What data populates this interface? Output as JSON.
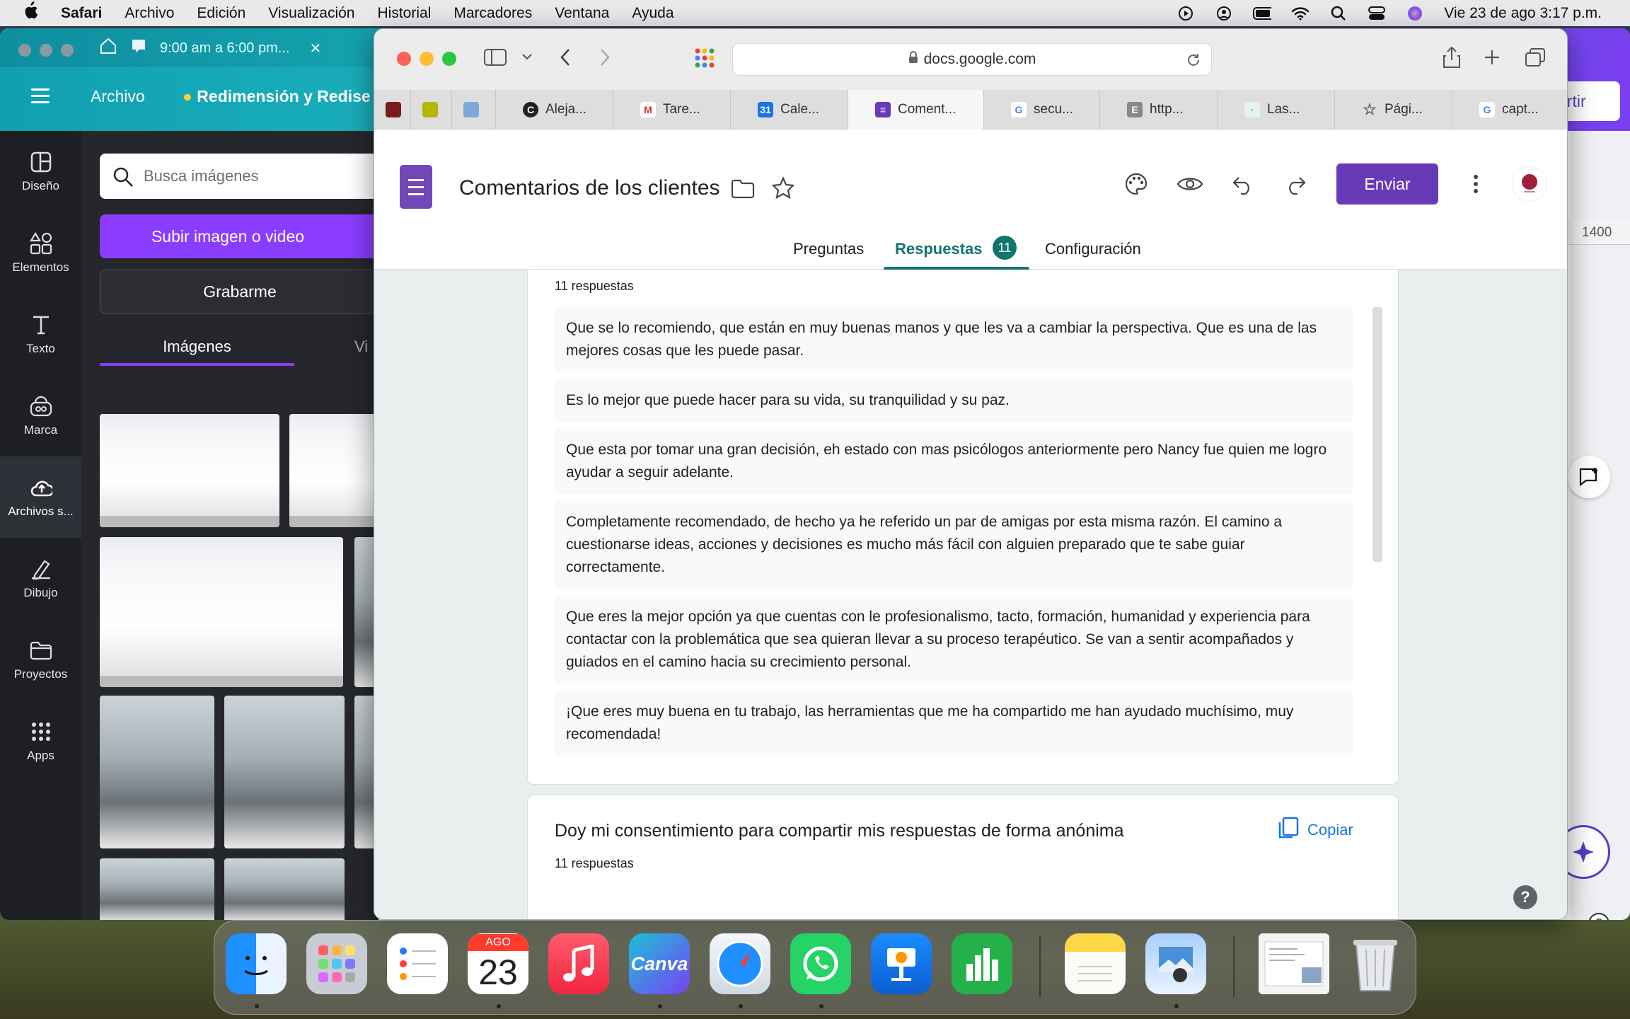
{
  "menubar": {
    "app": "Safari",
    "items": [
      "Archivo",
      "Edición",
      "Visualización",
      "Historial",
      "Marcadores",
      "Ventana",
      "Ayuda"
    ],
    "datetime": "Vie 23 de ago  3:17 p.m."
  },
  "canva": {
    "tab_title": "9:00 am a 6:00 pm...",
    "header": {
      "menu_label": "Archivo",
      "doc_name": "Redimensión y Redise",
      "share_label": "artir"
    },
    "sidebar": [
      {
        "label": "Diseño",
        "icon": "layout-icon"
      },
      {
        "label": "Elementos",
        "icon": "shapes-icon"
      },
      {
        "label": "Texto",
        "icon": "text-icon"
      },
      {
        "label": "Marca",
        "icon": "brand-icon"
      },
      {
        "label": "Archivos s...",
        "icon": "cloud-upload-icon"
      },
      {
        "label": "Dibujo",
        "icon": "pen-icon"
      },
      {
        "label": "Proyectos",
        "icon": "folder-icon"
      },
      {
        "label": "Apps",
        "icon": "apps-grid-icon"
      }
    ],
    "panel": {
      "search_placeholder": "Busca imágenes",
      "upload_label": "Subir imagen o video",
      "record_label": "Grabarme",
      "tab_images": "Imágenes",
      "tab_videos": "Vi"
    },
    "ruler_label": "1400"
  },
  "safari": {
    "url": "docs.google.com",
    "tabs": [
      {
        "title": "",
        "icon_color": "#7a1b1b"
      },
      {
        "title": "",
        "icon_color": "#b6b600"
      },
      {
        "title": "",
        "icon_color": "#7da7d9"
      },
      {
        "title": "Aleja...",
        "icon_color": "#222222"
      },
      {
        "title": "Tare...",
        "icon_color": "#d93025"
      },
      {
        "title": "Cale...",
        "icon_color": "#1a73e8"
      },
      {
        "title": "Coment...",
        "icon_color": "#673ab7"
      },
      {
        "title": "secu...",
        "icon_color": "#4285f4"
      },
      {
        "title": "http...",
        "icon_color": "#888888"
      },
      {
        "title": "Las...",
        "icon_color": "#4aa3a3"
      },
      {
        "title": "Pági...",
        "icon_color": "#666666"
      },
      {
        "title": "capt...",
        "icon_color": "#4285f4"
      }
    ]
  },
  "form": {
    "title": "Comentarios de los clientes",
    "send_label": "Enviar",
    "tabs": {
      "questions": "Preguntas",
      "responses": "Respuestas",
      "responses_count": "11",
      "settings": "Configuración"
    },
    "q1": {
      "count_label": "11 respuestas",
      "answers": [
        "Que se lo recomiendo, que están en muy buenas manos y que les va a cambiar la perspectiva. Que es una de las mejores cosas que les puede pasar.",
        "Es lo mejor que puede hacer para su vida, su tranquilidad y su paz.",
        "Que esta por tomar una gran decisión, eh estado con mas psicólogos anteriormente pero Nancy fue quien me logro ayudar a seguir adelante.",
        "Completamente recomendado, de hecho ya he referido un par de amigas por esta misma razón. El camino a cuestionarse ideas, acciones y decisiones es mucho más fácil con alguien preparado que te sabe guiar correctamente.",
        "Que eres la mejor opción ya que cuentas con le profesionalismo, tacto, formación, humanidad y experiencia para contactar con la problemática que sea quieran llevar a su proceso terapéutico. Se van a sentir acompañados y guiados en el camino hacia su crecimiento personal.",
        "¡Que eres muy buena en tu trabajo, las herramientas que me ha compartido me han ayudado muchísimo, muy recomendada!"
      ]
    },
    "q2": {
      "title": "Doy mi consentimiento para compartir mis respuestas de forma anónima",
      "copy_label": "Copiar",
      "count_label": "11 respuestas"
    }
  },
  "dock": {
    "calendar_month": "AGO",
    "calendar_day": "23",
    "canva_label": "Canva"
  }
}
